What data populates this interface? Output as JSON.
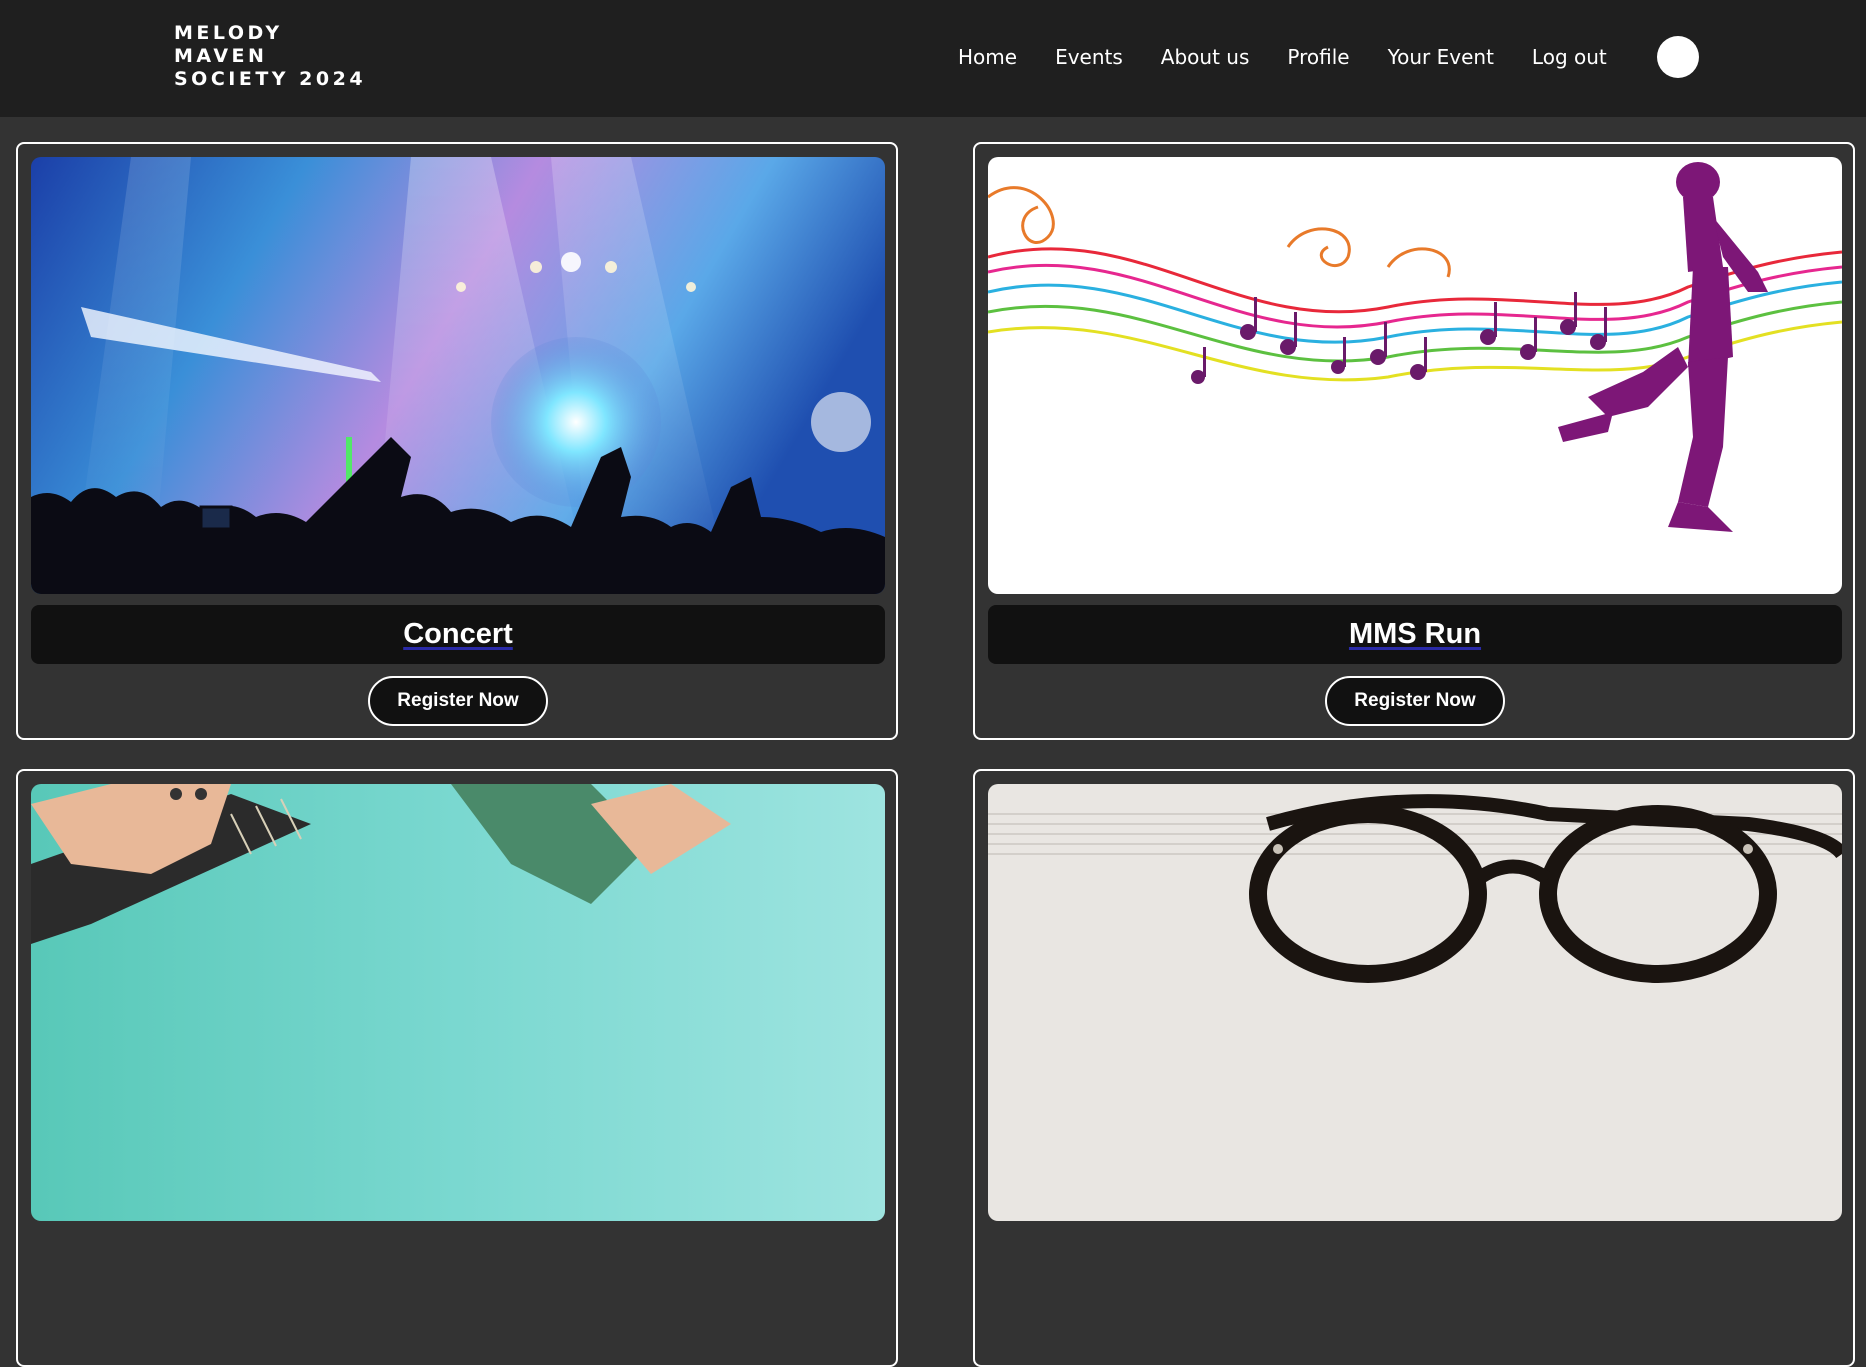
{
  "brand": {
    "line1": "MELODY",
    "line2": "MAVEN",
    "line3": "SOCIETY 2024"
  },
  "nav": {
    "items": [
      "Home",
      "Events",
      "About us",
      "Profile",
      "Your Event",
      "Log out"
    ]
  },
  "events": [
    {
      "title": "Concert",
      "button": "Register Now",
      "image": "concert-crowd-stage-lights"
    },
    {
      "title": "MMS Run",
      "button": "Register Now",
      "image": "runner-with-music-notes"
    },
    {
      "title": "",
      "button": "",
      "image": "guitar-performance"
    },
    {
      "title": "",
      "button": "",
      "image": "glasses-on-sheet-music"
    }
  ],
  "colors": {
    "page_bg": "#333333",
    "navbar_bg": "#1f1f1f",
    "title_bar_bg": "#111111",
    "link_underline": "#2a2aa8"
  }
}
